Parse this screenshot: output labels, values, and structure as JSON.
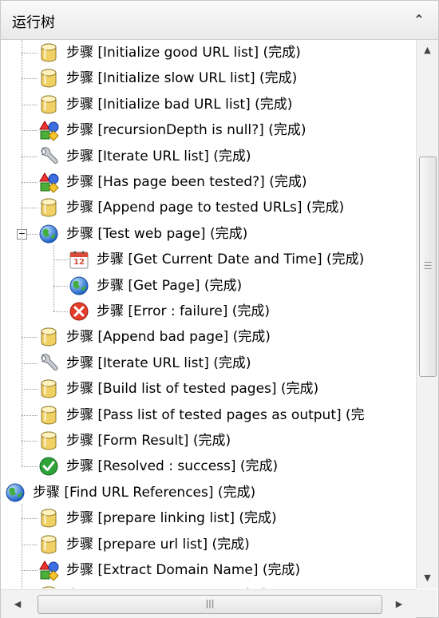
{
  "header": {
    "title": "运行树",
    "collapse_icon": "double-chevron-up-icon"
  },
  "tree": [
    {
      "label": "步骤 [Initialize good URL list] (完成)",
      "icon": "database-icon",
      "level": 1
    },
    {
      "label": "步骤 [Initialize slow URL list] (完成)",
      "icon": "database-icon",
      "level": 1
    },
    {
      "label": "步骤 [Initialize bad URL list] (完成)",
      "icon": "database-icon",
      "level": 1
    },
    {
      "label": "步骤 [recursionDepth is null?] (完成)",
      "icon": "decision-shapes-icon",
      "level": 1
    },
    {
      "label": "步骤 [Iterate URL list] (完成)",
      "icon": "wrench-icon",
      "level": 1
    },
    {
      "label": "步骤 [Has page been tested?] (完成)",
      "icon": "decision-shapes-icon",
      "level": 1
    },
    {
      "label": "步骤 [Append page to tested URLs] (完成)",
      "icon": "database-icon",
      "level": 1
    },
    {
      "label": "步骤 [Test web page] (完成)",
      "icon": "globe-icon",
      "level": 1,
      "expanded": true
    },
    {
      "label": "步骤 [Get Current Date and Time] (完成)",
      "icon": "calendar-icon",
      "level": 2,
      "calendar_text": "12"
    },
    {
      "label": "步骤 [Get Page] (完成)",
      "icon": "globe-icon",
      "level": 2
    },
    {
      "label": "步骤 [Error : failure] (完成)",
      "icon": "error-icon",
      "level": 2
    },
    {
      "label": "步骤 [Append bad page] (完成)",
      "icon": "database-icon",
      "level": 1
    },
    {
      "label": "步骤 [Iterate URL list] (完成)",
      "icon": "wrench-icon",
      "level": 1
    },
    {
      "label": "步骤 [Build list of tested pages] (完成)",
      "icon": "database-icon",
      "level": 1
    },
    {
      "label": "步骤 [Pass list of tested pages as output] (完",
      "icon": "database-icon",
      "level": 1
    },
    {
      "label": "步骤 [Form Result] (完成)",
      "icon": "database-icon",
      "level": 1
    },
    {
      "label": "步骤 [Resolved : success] (完成)",
      "icon": "success-icon",
      "level": 1
    },
    {
      "label": "步骤 [Find URL References] (完成)",
      "icon": "globe-icon",
      "level": 0
    },
    {
      "label": "步骤 [prepare linking list] (完成)",
      "icon": "database-icon",
      "level": 1
    },
    {
      "label": "步骤 [prepare url list] (完成)",
      "icon": "database-icon",
      "level": 1
    },
    {
      "label": "步骤 [Extract Domain Name] (完成)",
      "icon": "decision-shapes-icon",
      "level": 1
    },
    {
      "label": "步骤 [Context Appender] (完成)",
      "icon": "database-icon",
      "level": 1
    }
  ],
  "scrollbars": {
    "vertical": {
      "up_icon": "arrow-up-icon",
      "down_icon": "arrow-down-icon",
      "position_fraction": 0.2
    },
    "horizontal": {
      "left_icon": "arrow-left-icon",
      "right_icon": "arrow-right-icon"
    }
  }
}
